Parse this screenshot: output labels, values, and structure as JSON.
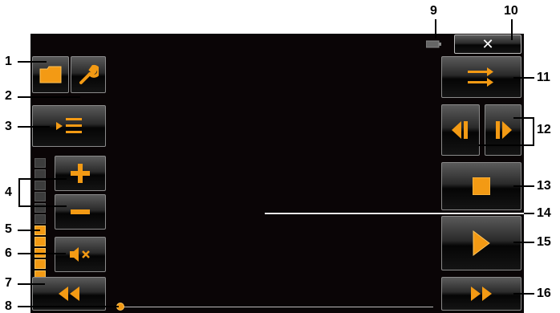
{
  "callouts": [
    "1",
    "2",
    "3",
    "4",
    "5",
    "6",
    "7",
    "8",
    "9",
    "10",
    "11",
    "12",
    "13",
    "14",
    "15",
    "16"
  ],
  "close_glyph": "✕",
  "volume": {
    "level_fraction": 0.5,
    "segments_total": 14,
    "segments_on": 7
  },
  "playback_position_fraction": 0.0,
  "colors": {
    "accent": "#f39a14",
    "screen_bg": "#0a0506",
    "callout_line": "#000000",
    "inner_line": "#e8e8e8"
  },
  "icons": [
    "folder-icon",
    "wrench-icon",
    "playlist-icon",
    "plus-icon",
    "minus-icon",
    "mute-icon",
    "rewind-icon",
    "forward-icon",
    "repeat-icon",
    "previous-track-icon",
    "next-track-icon",
    "stop-icon",
    "play-icon",
    "battery-icon"
  ]
}
